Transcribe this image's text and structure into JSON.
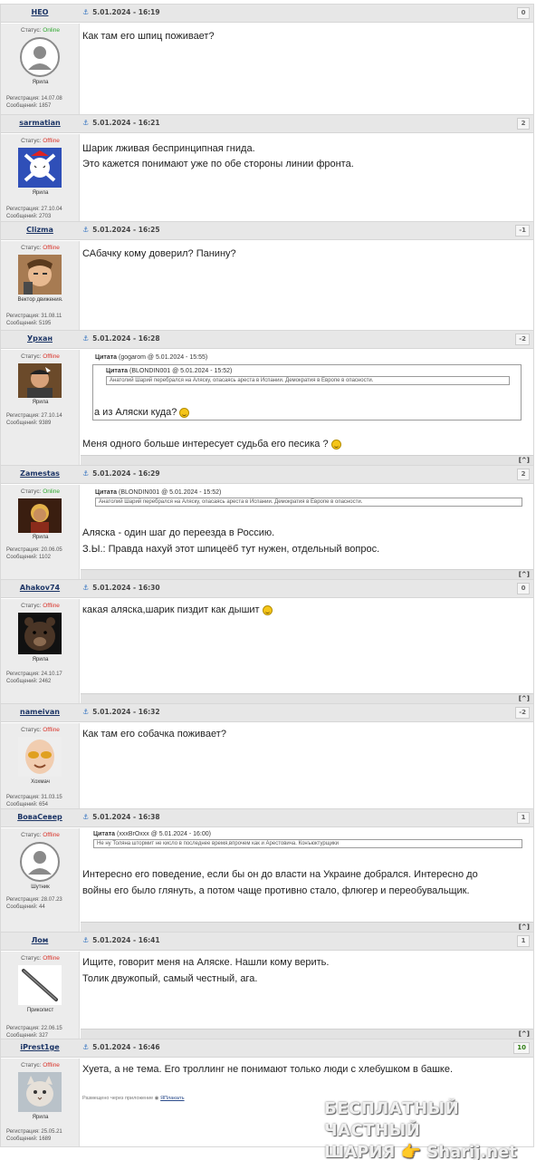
{
  "posts": [
    {
      "nick": "НЕО",
      "status_label": "Статус:",
      "status": "Online",
      "rank": "Ярила",
      "reg": "Регистрация: 14.07.08",
      "count": "Сообщений: 1857",
      "date": "5.01.2024 - 16:19",
      "rating": "0",
      "lines": [
        "Как там его шпиц поживает?"
      ]
    },
    {
      "nick": "sarmatian",
      "status_label": "Статус:",
      "status": "Offline",
      "rank": "Ярила",
      "reg": "Регистрация: 27.10.04",
      "count": "Сообщений: 2703",
      "date": "5.01.2024 - 16:21",
      "rating": "2",
      "lines": [
        "Шарик лживая беспринципная гнида.",
        "Это кажется понимают уже по обе стороны линии фронта."
      ]
    },
    {
      "nick": "Clizma",
      "status_label": "Статус:",
      "status": "Offline",
      "rank": "Вектор движения.",
      "reg": "Регистрация: 31.08.11",
      "count": "Сообщений: 5195",
      "date": "5.01.2024 - 16:25",
      "rating": "-1",
      "lines": [
        "САбачку кому доверил? Панину?"
      ]
    },
    {
      "nick": "Урхан",
      "status_label": "Статус:",
      "status": "Offline",
      "rank": "Ярила",
      "reg": "Регистрация: 27.10.14",
      "count": "Сообщений: 9389",
      "date": "5.01.2024 - 16:28",
      "rating": "-2",
      "quote_outer": {
        "label": "Цитата",
        "meta": "(gogarom @ 5.01.2024 - 15:55)",
        "reply": "а из Аляски куда?"
      },
      "quote_inner": {
        "label": "Цитата",
        "meta": "(BLONDIN001 @ 5.01.2024 - 15:52)",
        "text": "Анатолий Шарий перебрался на Аляску, опасаясь ареста в Испании. Демократия в Европе в опасности."
      },
      "lines": [
        "Меня одного больше интересует судьба его песика ?"
      ],
      "up": "[^]"
    },
    {
      "nick": "Zamestas",
      "status_label": "Статус:",
      "status": "Online",
      "rank": "Ярила",
      "reg": "Регистрация: 20.06.05",
      "count": "Сообщений: 1102",
      "date": "5.01.2024 - 16:29",
      "rating": "2",
      "quote": {
        "label": "Цитата",
        "meta": "(BLONDIN001 @ 5.01.2024 - 15:52)",
        "text": "Анатолий Шарий перебрался на Аляску, опасаясь ареста в Испании. Демократия в Европе в опасности."
      },
      "lines": [
        "Аляска - один шаг до переезда в Россию.",
        "З.Ы.: Правда нахуй этот шпицеёб тут нужен, отдельный вопрос."
      ],
      "up": "[^]"
    },
    {
      "nick": "Ahakov74",
      "status_label": "Статус:",
      "status": "Offline",
      "rank": "Ярила",
      "reg": "Регистрация: 24.10.17",
      "count": "Сообщений: 2462",
      "date": "5.01.2024 - 16:30",
      "rating": "0",
      "lines": [
        "какая аляска,шарик пиздит как дышит"
      ],
      "up": "[^]"
    },
    {
      "nick": "nameivan",
      "status_label": "Статус:",
      "status": "Offline",
      "rank": "Хохмач",
      "reg": "Регистрация: 31.03.15",
      "count": "Сообщений: 654",
      "date": "5.01.2024 - 16:32",
      "rating": "-2",
      "lines": [
        "Как там его собачка поживает?"
      ]
    },
    {
      "nick": "ВоваСевер",
      "status_label": "Статус:",
      "status": "Offline",
      "rank": "Шутник",
      "reg": "Регистрация: 28.07.23",
      "count": "Сообщений: 44",
      "date": "5.01.2024 - 16:38",
      "rating": "1",
      "quote": {
        "label": "Цитата",
        "meta": "(xxxBrOxxx @ 5.01.2024 - 16:00)",
        "text": "Не ну Толяна штормит не кисло в последнее время,впрочем как и Арестовича. Конъюктурщики"
      },
      "lines": [
        "Интересно его поведение, если бы он до власти на Украине добрался. Интересно до",
        "войны его было глянуть, а потом чаще противно стало, флюгер и переобувальщик."
      ],
      "up": "[^]"
    },
    {
      "nick": "Лом",
      "status_label": "Статус:",
      "status": "Offline",
      "rank": "Приколист",
      "reg": "Регистрация: 22.06.15",
      "count": "Сообщений: 327",
      "date": "5.01.2024 - 16:41",
      "rating": "1",
      "lines": [
        "Ищите, говорит меня на Аляске. Нашли кому верить.",
        "Толик двужопый, самый честный, ага."
      ],
      "up": "[^]"
    },
    {
      "nick": "iPrest1ge",
      "status_label": "Статус:",
      "status": "Offline",
      "rank": "Ярила",
      "reg": "Регистрация: 25.05.21",
      "count": "Сообщений: 1689",
      "date": "5.01.2024 - 16:46",
      "rating": "10",
      "lines": [
        "Хуета, а не тема. Его троллинг не понимают только люди с хлебушком в башке."
      ],
      "app_prefix": "Размещено через приложение",
      "app_name": "ЯПлакалъ"
    }
  ],
  "watermark": {
    "line1": "БЕСПЛАТНЫЙ ЧАСТНЫЙ",
    "line2": "ШАРИЯ 👉 Sharij.net"
  }
}
